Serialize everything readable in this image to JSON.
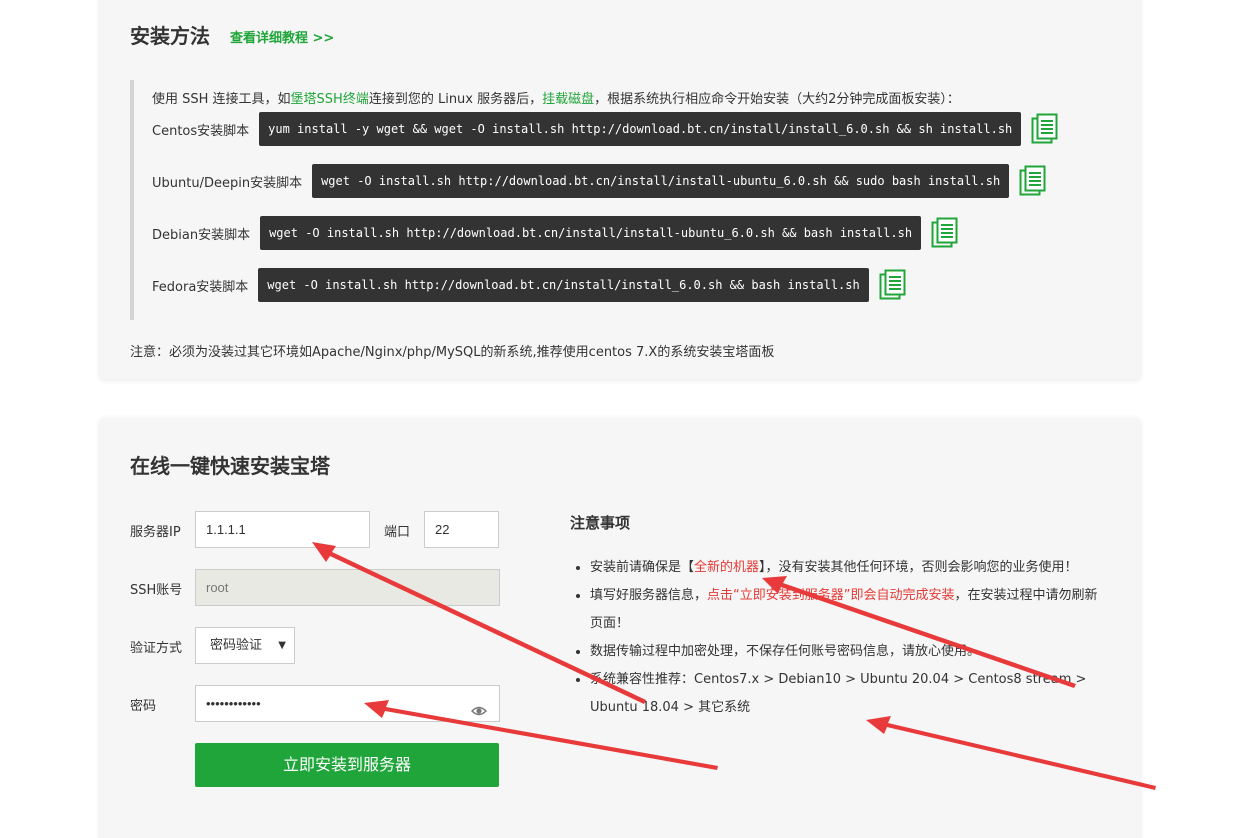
{
  "install_section": {
    "title": "安装方法",
    "tutorial_link": "查看详细教程 >>",
    "intro_part1": "使用 SSH 连接工具，如",
    "intro_link1": "堡塔SSH终端",
    "intro_part2": "连接到您的 Linux 服务器后，",
    "intro_link2": "挂载磁盘",
    "intro_part3": "，根据系统执行相应命令开始安装（大约2分钟完成面板安装）：",
    "scripts": [
      {
        "label": "Centos安装脚本",
        "command": "yum install -y wget && wget -O install.sh http://download.bt.cn/install/install_6.0.sh && sh install.sh"
      },
      {
        "label": "Ubuntu/Deepin安装脚本",
        "command": "wget -O install.sh http://download.bt.cn/install/install-ubuntu_6.0.sh && sudo bash install.sh"
      },
      {
        "label": "Debian安装脚本",
        "command": "wget -O install.sh http://download.bt.cn/install/install-ubuntu_6.0.sh && bash install.sh"
      },
      {
        "label": "Fedora安装脚本",
        "command": "wget -O install.sh http://download.bt.cn/install/install_6.0.sh && bash install.sh"
      }
    ],
    "note": "注意：必须为没装过其它环境如Apache/Nginx/php/MySQL的新系统,推荐使用centos 7.X的系统安装宝塔面板"
  },
  "online_section": {
    "title": "在线一键快速安装宝塔",
    "server_ip_label": "服务器IP",
    "server_ip_value": "1.1.1.1",
    "port_label": "端口",
    "port_value": "22",
    "ssh_account_label": "SSH账号",
    "ssh_account_value": "root",
    "auth_method_label": "验证方式",
    "auth_method_value": "密码验证",
    "password_label": "密码",
    "password_value": "••••••••••••",
    "install_button": "立即安装到服务器"
  },
  "notice": {
    "title": "注意事项",
    "item1_a": "安装前请确保是【",
    "item1_red": "全新的机器",
    "item1_b": "】，没有安装其他任何环境，否则会影响您的业务使用！",
    "item2_a": "填写好服务器信息，",
    "item2_red": "点击“立即安装到服务器”即会自动完成安装",
    "item2_b": "，在安装过程中请勿刷新页面！",
    "item3": "数据传输过程中加密处理，不保存任何账号密码信息，请放心使用。",
    "item4": "系统兼容性推荐：Centos7.x > Debian10 > Ubuntu 20.04 > Centos8 stream > Ubuntu 18.04 > 其它系统"
  },
  "colors": {
    "accent": "#20a53a",
    "code_bg": "#333333",
    "warning": "#e53935",
    "arrow": "#e83a3a"
  },
  "icons": {
    "copy": "copy-icon",
    "eye": "eye-icon",
    "dropdown": "caret-down-icon"
  }
}
